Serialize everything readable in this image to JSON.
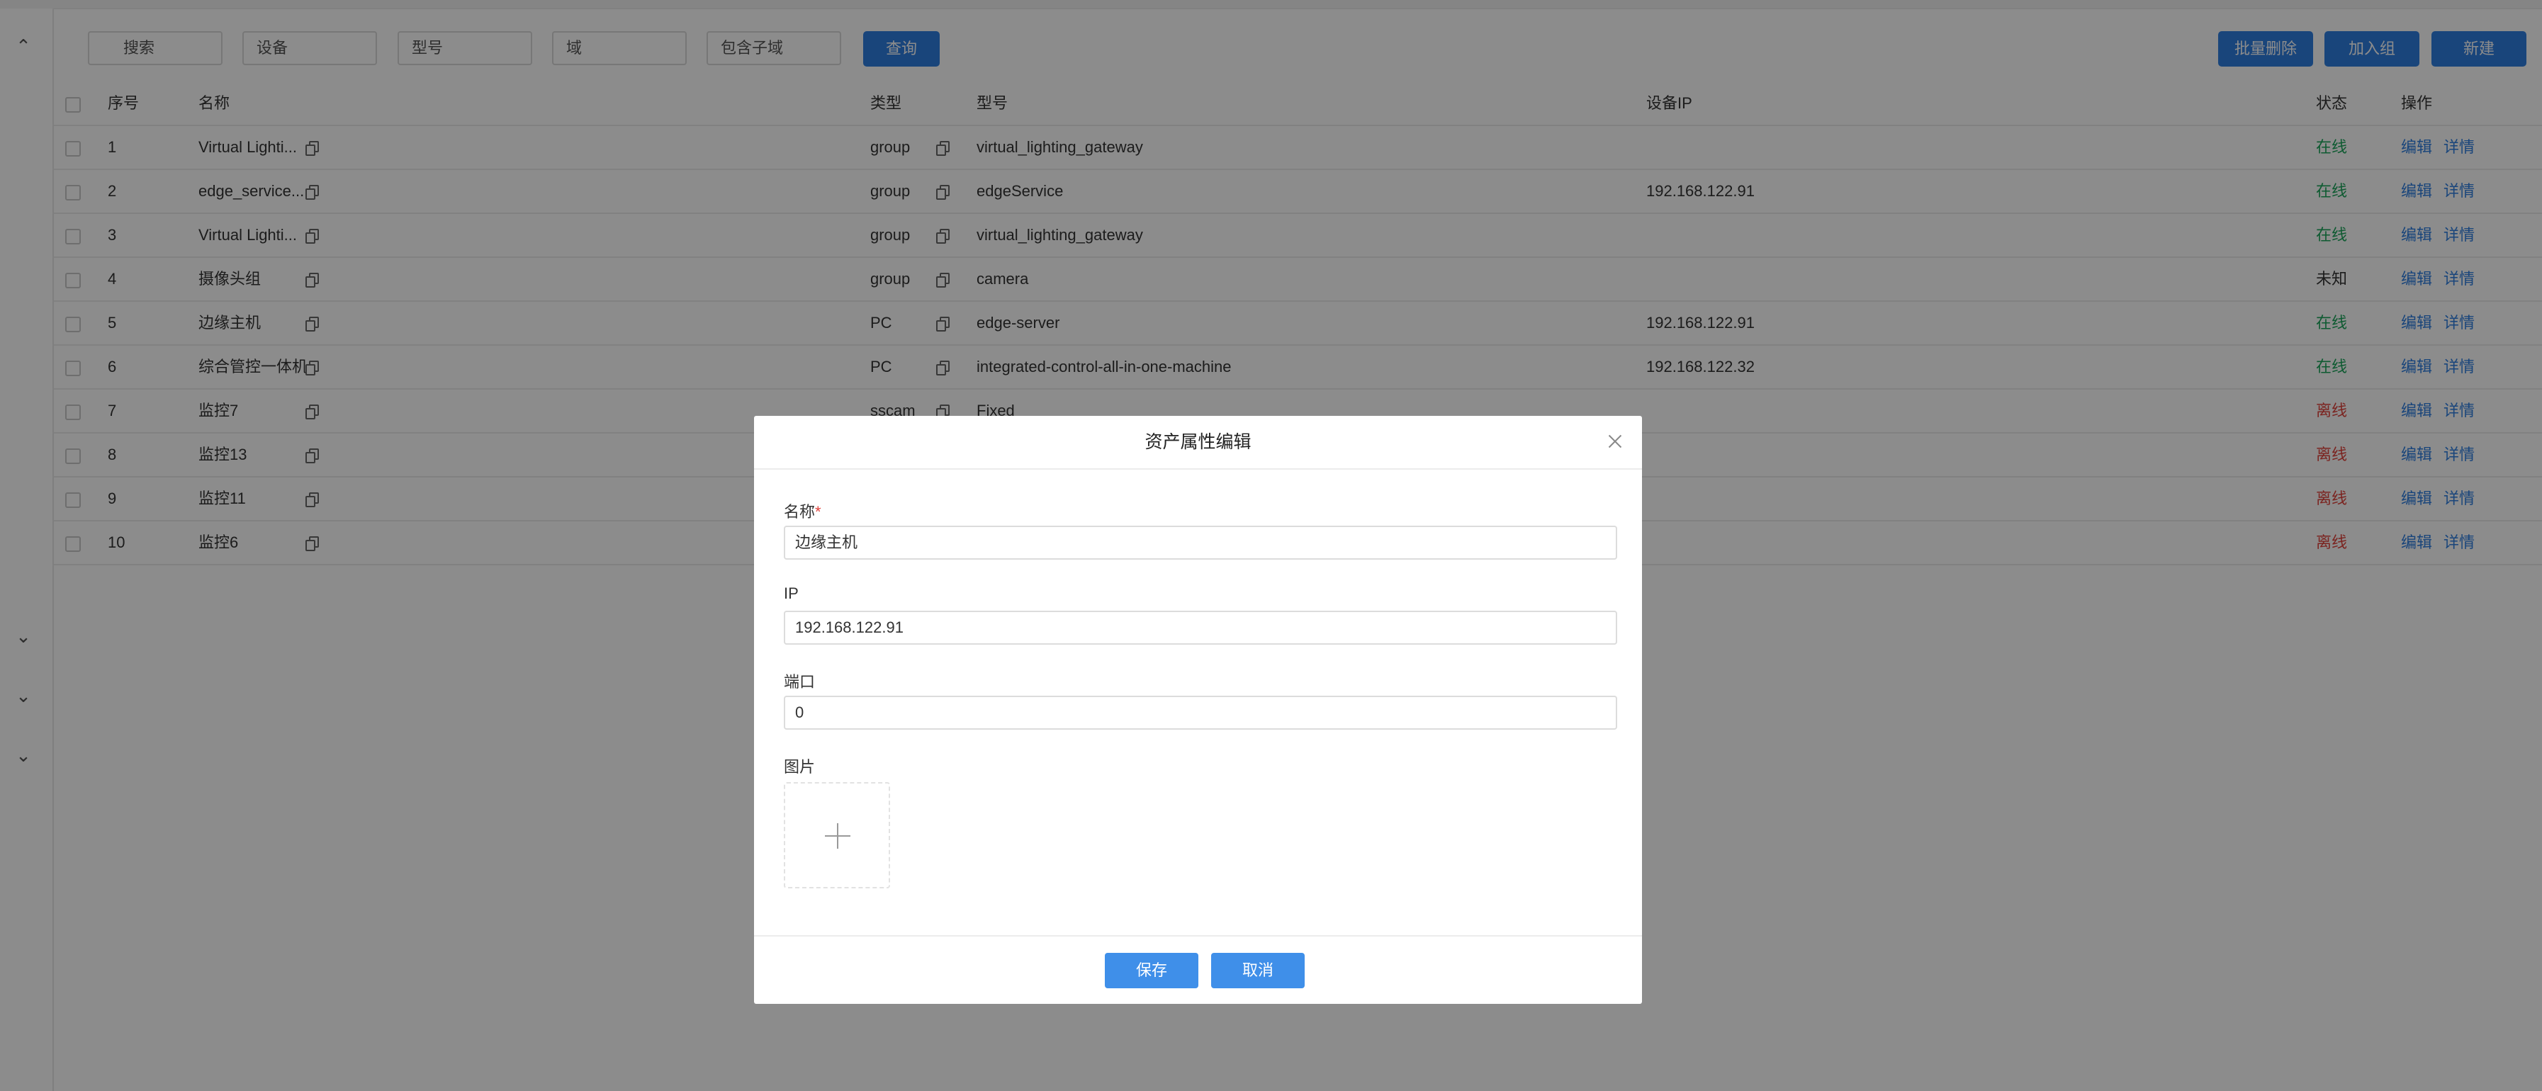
{
  "filters": {
    "search_placeholder": "搜索",
    "device_placeholder": "设备",
    "model_placeholder": "型号",
    "domain_placeholder": "域",
    "include_subdomain_label": "包含子域",
    "query_button": "查询"
  },
  "toolbar": {
    "batch_delete": "批量删除",
    "add_to_group": "加入组",
    "new": "新建"
  },
  "table": {
    "headers": {
      "index": "序号",
      "name": "名称",
      "type": "类型",
      "model": "型号",
      "ip": "设备IP",
      "status": "状态",
      "actions": "操作"
    },
    "action_edit": "编辑",
    "action_detail": "详情",
    "rows": [
      {
        "index": "1",
        "name": "Virtual Lighti...",
        "type": "group",
        "model": "virtual_lighting_gateway",
        "ip": "",
        "status": "在线",
        "status_kind": "online"
      },
      {
        "index": "2",
        "name": "edge_service...",
        "type": "group",
        "model": "edgeService",
        "ip": "192.168.122.91",
        "status": "在线",
        "status_kind": "online"
      },
      {
        "index": "3",
        "name": "Virtual Lighti...",
        "type": "group",
        "model": "virtual_lighting_gateway",
        "ip": "",
        "status": "在线",
        "status_kind": "online"
      },
      {
        "index": "4",
        "name": "摄像头组",
        "type": "group",
        "model": "camera",
        "ip": "",
        "status": "未知",
        "status_kind": "unknown"
      },
      {
        "index": "5",
        "name": "边缘主机",
        "type": "PC",
        "model": "edge-server",
        "ip": "192.168.122.91",
        "status": "在线",
        "status_kind": "online"
      },
      {
        "index": "6",
        "name": "综合管控一体机",
        "type": "PC",
        "model": "integrated-control-all-in-one-machine",
        "ip": "192.168.122.32",
        "status": "在线",
        "status_kind": "online"
      },
      {
        "index": "7",
        "name": "监控7",
        "type": "sscam",
        "model": "Fixed",
        "ip": "",
        "status": "离线",
        "status_kind": "offline"
      },
      {
        "index": "8",
        "name": "监控13",
        "type": "",
        "model": "",
        "ip": "",
        "status": "离线",
        "status_kind": "offline"
      },
      {
        "index": "9",
        "name": "监控11",
        "type": "",
        "model": "",
        "ip": "",
        "status": "离线",
        "status_kind": "offline"
      },
      {
        "index": "10",
        "name": "监控6",
        "type": "",
        "model": "",
        "ip": "",
        "status": "离线",
        "status_kind": "offline"
      }
    ]
  },
  "sidebar": {
    "icons": [
      "chevron-up-icon",
      "chevron-down-icon",
      "chevron-down-icon",
      "chevron-down-icon"
    ]
  },
  "modal": {
    "title": "资产属性编辑",
    "name_label": "名称",
    "required_mark": "*",
    "name_value": "边缘主机",
    "ip_label": "IP",
    "ip_value": "192.168.122.91",
    "port_label": "端口",
    "port_value": "0",
    "image_label": "图片",
    "save_button": "保存",
    "cancel_button": "取消"
  },
  "colors": {
    "primary": "#2f7fe0",
    "online": "#1aa55a",
    "offline": "#e0423b",
    "overlay": "rgba(0,0,0,0.45)"
  }
}
